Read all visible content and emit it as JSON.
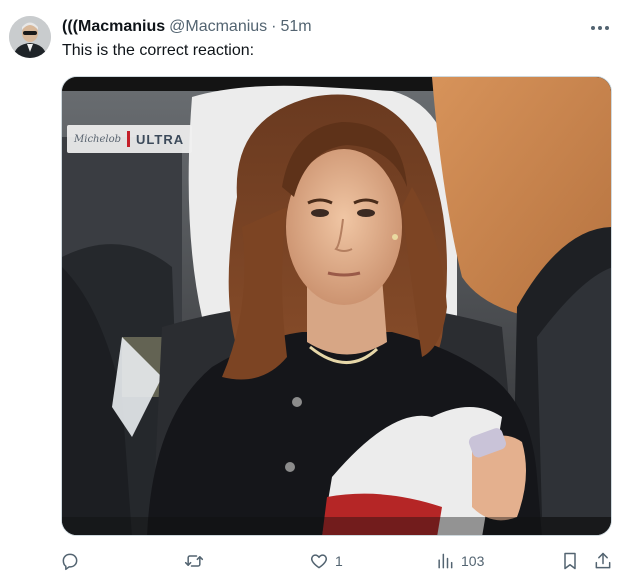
{
  "author": {
    "display_name": "(((Macmanius",
    "handle": "@Macmanius",
    "separator": "·",
    "time": "51m",
    "avatar_icon": "avatar-photo"
  },
  "tweet": {
    "text": "This is the correct reaction:"
  },
  "media": {
    "sponsor_script": "Michelob",
    "sponsor_word": "ULTRA",
    "sponsor_bar_color": "#c4202a"
  },
  "actions": {
    "reply": {
      "icon": "reply-icon",
      "count": ""
    },
    "retweet": {
      "icon": "retweet-icon",
      "count": ""
    },
    "like": {
      "icon": "heart-icon",
      "count": "1"
    },
    "views": {
      "icon": "views-icon",
      "count": "103"
    },
    "bookmark": {
      "icon": "bookmark-icon"
    },
    "share": {
      "icon": "share-icon"
    }
  },
  "colors": {
    "text_primary": "#0f1419",
    "text_secondary": "#536471",
    "border": "#cfd9de"
  }
}
